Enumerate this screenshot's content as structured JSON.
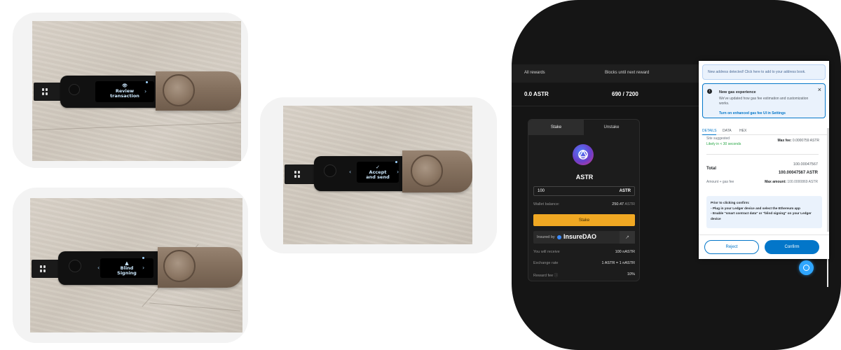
{
  "photos": {
    "review": {
      "line1": "Review",
      "line2": "transaction"
    },
    "blind": {
      "line1": "Blind",
      "line2": "Signing"
    },
    "accept": {
      "line1": "Accept",
      "line2": "and send"
    }
  },
  "dapp": {
    "headers": {
      "all_rewards": "All rewards",
      "blocks_until": "Blocks until next reward"
    },
    "values": {
      "rewards": "0.0 ASTR",
      "blocks": "690 / 7200"
    },
    "tabs": [
      "Stake",
      "Unstake"
    ],
    "token": "ASTR",
    "amount": {
      "value": "100",
      "unit": "ASTR"
    },
    "wallet_balance": {
      "label": "Wallet balance:",
      "value": "250.47",
      "unit": "ASTR"
    },
    "stake_button": "Stake",
    "insured": {
      "label": "Insured by",
      "brand": "InsureDAO",
      "ext": "↗"
    },
    "you_will_receive": {
      "label": "You will receive",
      "value": "100 nASTR"
    },
    "exchange_rate": {
      "label": "Exchange rate",
      "value": "1 ASTR = 1 nASTR"
    },
    "reward_fee": {
      "label": "Reward fee ⓘ",
      "value": "10%"
    }
  },
  "metamask": {
    "banner": "New address detected! Click here to add to your address book.",
    "info_title": "New gas experience",
    "info_desc": "We've updated how gas fee estimation and customization works.",
    "info_link": "Turn on enhanced gas fee UI in Settings",
    "close": "×",
    "tabs": [
      "DETAILS",
      "DATA",
      "HEX"
    ],
    "site_suggested": "Site suggested",
    "likely": "Likely in < 30 seconds",
    "max_fee_label": "Max fee:",
    "max_fee_value": "0.0000759 ASTR",
    "total_label": "Total",
    "total_small": "100.00047567",
    "total_big": "100.00047567 ASTR",
    "amount_gas": "Amount + gas fee",
    "max_amount_label": "Max amount:",
    "max_amount_value": "100.0000869 ASTR",
    "note_line1": "Prior to clicking confirm:",
    "note_line2": "- Plug in your Ledger device and select the Ethereum app",
    "note_line3": "- Enable \"smart contract data\" or \"blind signing\" on your Ledger device",
    "reject": "Reject",
    "confirm": "Confirm"
  }
}
